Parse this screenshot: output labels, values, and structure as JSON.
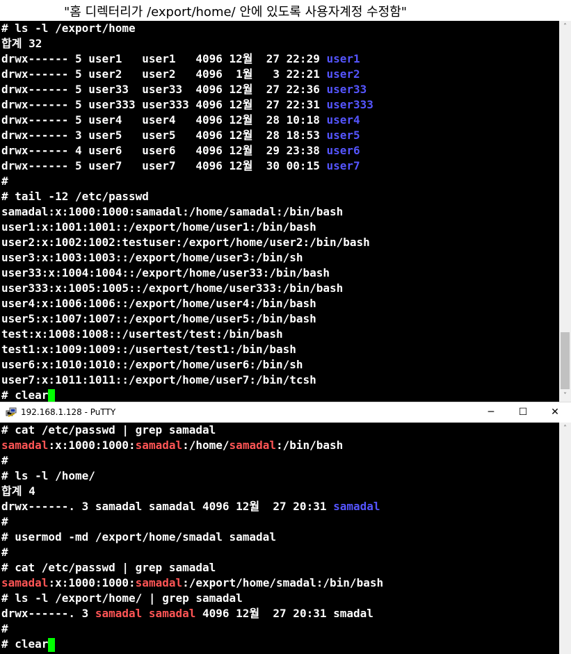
{
  "caption": "\"홈 디렉터리가 /export/home/ 안에 있도록 사용자계정 수정함\"",
  "terminal1": {
    "lines": [
      [
        {
          "t": "# ls -l /export/home"
        }
      ],
      [
        {
          "t": "합계 32"
        }
      ],
      [
        {
          "t": "drwx------ 5 user1   user1   4096 12월  27 22:29 "
        },
        {
          "t": "user1",
          "c": "blue"
        }
      ],
      [
        {
          "t": "drwx------ 5 user2   user2   4096  1월   3 22:21 "
        },
        {
          "t": "user2",
          "c": "blue"
        }
      ],
      [
        {
          "t": "drwx------ 5 user33  user33  4096 12월  27 22:36 "
        },
        {
          "t": "user33",
          "c": "blue"
        }
      ],
      [
        {
          "t": "drwx------ 5 user333 user333 4096 12월  27 22:31 "
        },
        {
          "t": "user333",
          "c": "blue"
        }
      ],
      [
        {
          "t": "drwx------ 5 user4   user4   4096 12월  28 10:18 "
        },
        {
          "t": "user4",
          "c": "blue"
        }
      ],
      [
        {
          "t": "drwx------ 3 user5   user5   4096 12월  28 18:53 "
        },
        {
          "t": "user5",
          "c": "blue"
        }
      ],
      [
        {
          "t": "drwx------ 4 user6   user6   4096 12월  29 23:38 "
        },
        {
          "t": "user6",
          "c": "blue"
        }
      ],
      [
        {
          "t": "drwx------ 5 user7   user7   4096 12월  30 00:15 "
        },
        {
          "t": "user7",
          "c": "blue"
        }
      ],
      [
        {
          "t": "#"
        }
      ],
      [
        {
          "t": "# tail -12 /etc/passwd"
        }
      ],
      [
        {
          "t": "samadal:x:1000:1000:samadal:/home/samadal:/bin/bash"
        }
      ],
      [
        {
          "t": "user1:x:1001:1001::/export/home/user1:/bin/bash"
        }
      ],
      [
        {
          "t": "user2:x:1002:1002:testuser:/export/home/user2:/bin/bash"
        }
      ],
      [
        {
          "t": "user3:x:1003:1003::/export/home/user3:/bin/sh"
        }
      ],
      [
        {
          "t": "user33:x:1004:1004::/export/home/user33:/bin/bash"
        }
      ],
      [
        {
          "t": "user333:x:1005:1005::/export/home/user333:/bin/bash"
        }
      ],
      [
        {
          "t": "user4:x:1006:1006::/export/home/user4:/bin/bash"
        }
      ],
      [
        {
          "t": "user5:x:1007:1007::/export/home/user5:/bin/bash"
        }
      ],
      [
        {
          "t": "test:x:1008:1008::/usertest/test:/bin/bash"
        }
      ],
      [
        {
          "t": "test1:x:1009:1009::/usertest/test1:/bin/bash"
        }
      ],
      [
        {
          "t": "user6:x:1010:1010::/export/home/user6:/bin/sh"
        }
      ],
      [
        {
          "t": "user7:x:1011:1011::/export/home/user7:/bin/tcsh"
        }
      ],
      [
        {
          "t": "# clear"
        },
        {
          "cursor": true
        }
      ]
    ]
  },
  "window": {
    "title": "192.168.1.128 - PuTTY",
    "min_glyph": "─",
    "max_glyph": "☐",
    "close_glyph": "✕"
  },
  "terminal2": {
    "lines": [
      [
        {
          "t": "# cat /etc/passwd | grep samadal"
        }
      ],
      [
        {
          "t": "samadal",
          "c": "red"
        },
        {
          "t": ":x:1000:1000:"
        },
        {
          "t": "samadal",
          "c": "red"
        },
        {
          "t": ":/home/"
        },
        {
          "t": "samadal",
          "c": "red"
        },
        {
          "t": ":/bin/bash"
        }
      ],
      [
        {
          "t": "#"
        }
      ],
      [
        {
          "t": "# ls -l /home/"
        }
      ],
      [
        {
          "t": "합계 4"
        }
      ],
      [
        {
          "t": "drwx------. 3 samadal samadal 4096 12월  27 20:31 "
        },
        {
          "t": "samadal",
          "c": "blue"
        }
      ],
      [
        {
          "t": "#"
        }
      ],
      [
        {
          "t": "# usermod -md /export/home/smadal samadal"
        }
      ],
      [
        {
          "t": "#"
        }
      ],
      [
        {
          "t": "# cat /etc/passwd | grep samadal"
        }
      ],
      [
        {
          "t": "samadal",
          "c": "red"
        },
        {
          "t": ":x:1000:1000:"
        },
        {
          "t": "samadal",
          "c": "red"
        },
        {
          "t": ":/export/home/smadal:/bin/bash"
        }
      ],
      [
        {
          "t": "# ls -l /export/home/ | grep samadal"
        }
      ],
      [
        {
          "t": "drwx------. 3 "
        },
        {
          "t": "samadal samadal",
          "c": "red"
        },
        {
          "t": " 4096 12월  27 20:31 smadal"
        }
      ],
      [
        {
          "t": "#"
        }
      ],
      [
        {
          "t": "# clear"
        },
        {
          "cursor": true
        }
      ]
    ]
  },
  "scroll": {
    "up_glyph": "˄",
    "down_glyph": "˅"
  },
  "colors": {
    "terminal_bg": "#000000",
    "text": "#ffffff",
    "dir_blue": "#5555ff",
    "match_red": "#ff5555",
    "cursor": "#00ff00"
  }
}
